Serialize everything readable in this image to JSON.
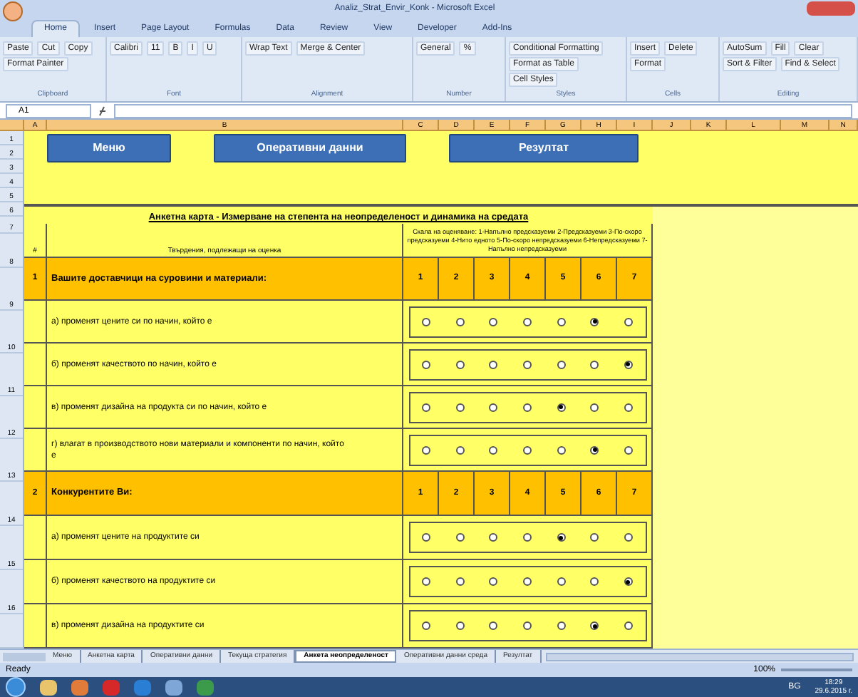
{
  "window": {
    "title": "Analiz_Strat_Envir_Konk - Microsoft Excel"
  },
  "ribbon_tabs": [
    {
      "label": "Home",
      "selected": true
    },
    {
      "label": "Insert",
      "selected": false
    },
    {
      "label": "Page Layout",
      "selected": false
    },
    {
      "label": "Formulas",
      "selected": false
    },
    {
      "label": "Data",
      "selected": false
    },
    {
      "label": "Review",
      "selected": false
    },
    {
      "label": "View",
      "selected": false
    },
    {
      "label": "Developer",
      "selected": false
    },
    {
      "label": "Add-Ins",
      "selected": false
    }
  ],
  "ribbon_groups": [
    {
      "label": "Clipboard",
      "commands": [
        "Paste",
        "Cut",
        "Copy",
        "Format Painter"
      ]
    },
    {
      "label": "Font",
      "commands": [
        "Calibri",
        "11",
        "B",
        "I",
        "U"
      ]
    },
    {
      "label": "Alignment",
      "commands": [
        "Wrap Text",
        "Merge & Center"
      ]
    },
    {
      "label": "Number",
      "commands": [
        "General",
        "%"
      ]
    },
    {
      "label": "Styles",
      "commands": [
        "Conditional Formatting",
        "Format as Table",
        "Cell Styles"
      ]
    },
    {
      "label": "Cells",
      "commands": [
        "Insert",
        "Delete",
        "Format"
      ]
    },
    {
      "label": "Editing",
      "commands": [
        "AutoSum",
        "Fill",
        "Clear",
        "Sort & Filter",
        "Find & Select"
      ]
    }
  ],
  "formula_bar": {
    "name_box": "A1"
  },
  "columns": [
    "A",
    "B",
    "C",
    "D",
    "E",
    "F",
    "G",
    "H",
    "I",
    "J",
    "K",
    "L",
    "M",
    "N"
  ],
  "rows": [
    "1",
    "2",
    "3",
    "4",
    "5",
    "6",
    "7",
    "8",
    "9",
    "10",
    "11",
    "12",
    "13",
    "14",
    "15",
    "16"
  ],
  "nav_buttons": [
    "Меню",
    "Оперативни данни",
    "Резултат"
  ],
  "form": {
    "title": "Анкетна карта - Измерване на степента на неопределеност и динамика на средата",
    "header": {
      "number": "#",
      "statement": "Твърдения, подлежащи на оценка",
      "scale": "Скала на оценяване: 1-Напълно предсказуеми 2-Предсказуеми 3-По-скоро предсказуеми 4-Нито едното 5-По-скоро непредсказуеми 6-Непредсказуеми 7-Напълно непредсказуеми"
    },
    "sections": [
      {
        "number": "1",
        "title": "Вашите доставчици на суровини и материали:",
        "scale_points": [
          "1",
          "2",
          "3",
          "4",
          "5",
          "6",
          "7"
        ],
        "questions": [
          {
            "text": "а) променят цените си по начин, който е",
            "options": [
              {
                "selected": false
              },
              {
                "selected": false
              },
              {
                "selected": false
              },
              {
                "selected": false
              },
              {
                "selected": false
              },
              {
                "selected": true
              },
              {
                "selected": false
              }
            ]
          },
          {
            "text": "б) променят качеството по начин, който е",
            "options": [
              {
                "selected": false
              },
              {
                "selected": false
              },
              {
                "selected": false
              },
              {
                "selected": false
              },
              {
                "selected": false
              },
              {
                "selected": false
              },
              {
                "selected": true
              }
            ]
          },
          {
            "text": "в) променят дизайна на продукта си по начин, който е",
            "options": [
              {
                "selected": false
              },
              {
                "selected": false
              },
              {
                "selected": false
              },
              {
                "selected": false
              },
              {
                "selected": true
              },
              {
                "selected": false
              },
              {
                "selected": false
              }
            ]
          },
          {
            "text": "г) влагат в производството нови материали и компоненти по начин, който е",
            "options": [
              {
                "selected": false
              },
              {
                "selected": false
              },
              {
                "selected": false
              },
              {
                "selected": false
              },
              {
                "selected": false
              },
              {
                "selected": true
              },
              {
                "selected": false
              }
            ]
          }
        ]
      },
      {
        "number": "2",
        "title": "Конкурентите Ви:",
        "scale_points": [
          "1",
          "2",
          "3",
          "4",
          "5",
          "6",
          "7"
        ],
        "questions": [
          {
            "text": "а) променят цените на продуктите си",
            "options": [
              {
                "selected": false
              },
              {
                "selected": false
              },
              {
                "selected": false
              },
              {
                "selected": false
              },
              {
                "selected": true
              },
              {
                "selected": false
              },
              {
                "selected": false
              }
            ]
          },
          {
            "text": "б) променят качеството на продуктите си",
            "options": [
              {
                "selected": false
              },
              {
                "selected": false
              },
              {
                "selected": false
              },
              {
                "selected": false
              },
              {
                "selected": false
              },
              {
                "selected": false
              },
              {
                "selected": true
              }
            ]
          },
          {
            "text": "в) променят дизайна на продуктите си",
            "options": [
              {
                "selected": false
              },
              {
                "selected": false
              },
              {
                "selected": false
              },
              {
                "selected": false
              },
              {
                "selected": false
              },
              {
                "selected": true
              },
              {
                "selected": false
              }
            ]
          }
        ]
      }
    ]
  },
  "sheet_tabs": [
    {
      "label": "Меню",
      "selected": false
    },
    {
      "label": "Анкетна карта",
      "selected": false
    },
    {
      "label": "Оперативни данни",
      "selected": false
    },
    {
      "label": "Текуща стратегия",
      "selected": false
    },
    {
      "label": "Анкета неопределеност",
      "selected": true
    },
    {
      "label": "Оперативни данни среда",
      "selected": false
    },
    {
      "label": "Резултат",
      "selected": false
    }
  ],
  "status_bar": {
    "status": "Ready",
    "zoom": "100%"
  },
  "taskbar": {
    "language": "BG",
    "time": "18:29",
    "date": "29.6.2015 г."
  }
}
